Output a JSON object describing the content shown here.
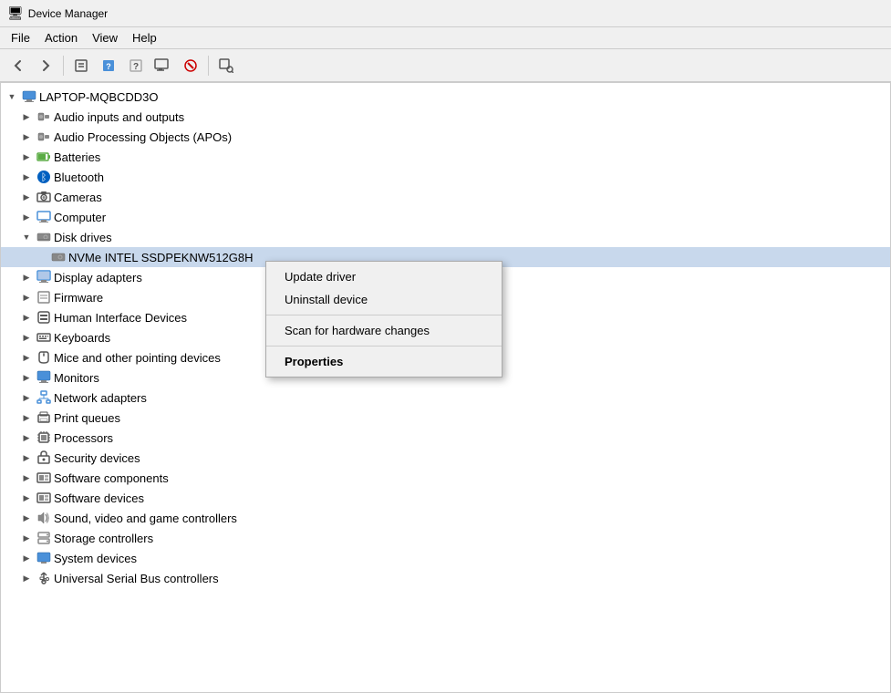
{
  "window": {
    "title": "Device Manager",
    "icon": "device-manager-icon"
  },
  "menubar": {
    "items": [
      {
        "id": "file",
        "label": "File"
      },
      {
        "id": "action",
        "label": "Action"
      },
      {
        "id": "view",
        "label": "View"
      },
      {
        "id": "help",
        "label": "Help"
      }
    ]
  },
  "toolbar": {
    "buttons": [
      {
        "id": "back",
        "label": "◀",
        "tooltip": "Back"
      },
      {
        "id": "forward",
        "label": "▶",
        "tooltip": "Forward"
      },
      {
        "id": "properties",
        "label": "🗒",
        "tooltip": "Properties"
      },
      {
        "id": "update",
        "label": "⬆",
        "tooltip": "Update driver"
      },
      {
        "id": "uninstall",
        "label": "✕",
        "tooltip": "Uninstall device"
      },
      {
        "id": "scan",
        "label": "🔍",
        "tooltip": "Scan for hardware changes"
      },
      {
        "id": "help",
        "label": "?",
        "tooltip": "Help"
      }
    ]
  },
  "tree": {
    "root": {
      "label": "LAPTOP-MQBCDD3O",
      "expanded": true,
      "items": [
        {
          "id": "audio",
          "label": "Audio inputs and outputs",
          "icon": "audio",
          "expanded": false,
          "indent": 1
        },
        {
          "id": "apo",
          "label": "Audio Processing Objects (APOs)",
          "icon": "audio",
          "expanded": false,
          "indent": 1
        },
        {
          "id": "batteries",
          "label": "Batteries",
          "icon": "battery",
          "expanded": false,
          "indent": 1
        },
        {
          "id": "bluetooth",
          "label": "Bluetooth",
          "icon": "bluetooth",
          "expanded": false,
          "indent": 1
        },
        {
          "id": "cameras",
          "label": "Cameras",
          "icon": "camera",
          "expanded": false,
          "indent": 1
        },
        {
          "id": "computer",
          "label": "Computer",
          "icon": "computer",
          "expanded": false,
          "indent": 1
        },
        {
          "id": "disk",
          "label": "Disk drives",
          "icon": "disk",
          "expanded": true,
          "indent": 1
        },
        {
          "id": "nvme",
          "label": "NVMe INTEL SSDPEKNW512G8H",
          "icon": "disk",
          "expanded": false,
          "indent": 2,
          "selected": true
        },
        {
          "id": "display",
          "label": "Display adapters",
          "icon": "display",
          "expanded": false,
          "indent": 1
        },
        {
          "id": "firmware",
          "label": "Firmware",
          "icon": "firmware",
          "expanded": false,
          "indent": 1
        },
        {
          "id": "hid",
          "label": "Human Interface Devices",
          "icon": "hid",
          "expanded": false,
          "indent": 1
        },
        {
          "id": "keyboards",
          "label": "Keyboards",
          "icon": "keyboard",
          "expanded": false,
          "indent": 1
        },
        {
          "id": "mice",
          "label": "Mice and other pointing devices",
          "icon": "mouse",
          "expanded": false,
          "indent": 1
        },
        {
          "id": "monitors",
          "label": "Monitors",
          "icon": "monitor",
          "expanded": false,
          "indent": 1
        },
        {
          "id": "network",
          "label": "Network adapters",
          "icon": "network",
          "expanded": false,
          "indent": 1
        },
        {
          "id": "print",
          "label": "Print queues",
          "icon": "print",
          "expanded": false,
          "indent": 1
        },
        {
          "id": "processors",
          "label": "Processors",
          "icon": "processor",
          "expanded": false,
          "indent": 1
        },
        {
          "id": "security",
          "label": "Security devices",
          "icon": "security",
          "expanded": false,
          "indent": 1
        },
        {
          "id": "softwarecomp",
          "label": "Software components",
          "icon": "software",
          "expanded": false,
          "indent": 1
        },
        {
          "id": "softwaredev",
          "label": "Software devices",
          "icon": "software",
          "expanded": false,
          "indent": 1
        },
        {
          "id": "sound",
          "label": "Sound, video and game controllers",
          "icon": "sound",
          "expanded": false,
          "indent": 1
        },
        {
          "id": "storage",
          "label": "Storage controllers",
          "icon": "storage",
          "expanded": false,
          "indent": 1
        },
        {
          "id": "system",
          "label": "System devices",
          "icon": "system",
          "expanded": false,
          "indent": 1
        },
        {
          "id": "usb",
          "label": "Universal Serial Bus controllers",
          "icon": "usb",
          "expanded": false,
          "indent": 1
        }
      ]
    }
  },
  "context_menu": {
    "visible": true,
    "items": [
      {
        "id": "update-driver",
        "label": "Update driver",
        "bold": false,
        "separator_after": false
      },
      {
        "id": "uninstall-device",
        "label": "Uninstall device",
        "bold": false,
        "separator_after": true
      },
      {
        "id": "scan-hardware",
        "label": "Scan for hardware changes",
        "bold": false,
        "separator_after": true
      },
      {
        "id": "properties",
        "label": "Properties",
        "bold": true,
        "separator_after": false
      }
    ]
  }
}
